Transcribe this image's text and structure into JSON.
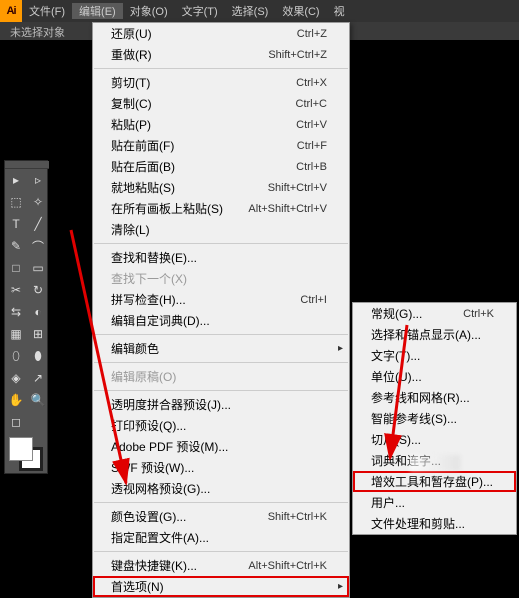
{
  "menubar": {
    "logo": "Ai",
    "items": [
      "文件(F)",
      "编辑(E)",
      "对象(O)",
      "文字(T)",
      "选择(S)",
      "效果(C)",
      "视"
    ]
  },
  "status": "未选择对象",
  "main_menu": [
    {
      "label": "还原(U)",
      "short": "Ctrl+Z"
    },
    {
      "label": "重做(R)",
      "short": "Shift+Ctrl+Z"
    },
    {
      "sep": true
    },
    {
      "label": "剪切(T)",
      "short": "Ctrl+X"
    },
    {
      "label": "复制(C)",
      "short": "Ctrl+C"
    },
    {
      "label": "粘贴(P)",
      "short": "Ctrl+V"
    },
    {
      "label": "贴在前面(F)",
      "short": "Ctrl+F"
    },
    {
      "label": "贴在后面(B)",
      "short": "Ctrl+B"
    },
    {
      "label": "就地粘贴(S)",
      "short": "Shift+Ctrl+V"
    },
    {
      "label": "在所有画板上粘贴(S)",
      "short": "Alt+Shift+Ctrl+V"
    },
    {
      "label": "清除(L)",
      "short": ""
    },
    {
      "sep": true
    },
    {
      "label": "查找和替换(E)...",
      "short": ""
    },
    {
      "label": "查找下一个(X)",
      "short": "",
      "disabled": true
    },
    {
      "label": "拼写检查(H)...",
      "short": "Ctrl+I"
    },
    {
      "label": "编辑自定词典(D)...",
      "short": ""
    },
    {
      "sep": true
    },
    {
      "label": "编辑颜色",
      "short": "",
      "sub": true
    },
    {
      "sep": true
    },
    {
      "label": "编辑原稿(O)",
      "short": "",
      "disabled": true
    },
    {
      "sep": true
    },
    {
      "label": "透明度拼合器预设(J)...",
      "short": ""
    },
    {
      "label": "打印预设(Q)...",
      "short": ""
    },
    {
      "label": "Adobe PDF 预设(M)...",
      "short": ""
    },
    {
      "label": "SWF 预设(W)...",
      "short": ""
    },
    {
      "label": "透视网格预设(G)...",
      "short": ""
    },
    {
      "sep": true
    },
    {
      "label": "颜色设置(G)...",
      "short": "Shift+Ctrl+K"
    },
    {
      "label": "指定配置文件(A)...",
      "short": ""
    },
    {
      "sep": true
    },
    {
      "label": "键盘快捷键(K)...",
      "short": "Alt+Shift+Ctrl+K"
    },
    {
      "label": "首选项(N)",
      "short": "",
      "sub": true,
      "hl": true
    }
  ],
  "sub_menu": [
    {
      "label": "常规(G)...",
      "short": "Ctrl+K"
    },
    {
      "label": "选择和锚点显示(A)...",
      "short": ""
    },
    {
      "label": "文字(T)...",
      "short": ""
    },
    {
      "label": "单位(U)...",
      "short": ""
    },
    {
      "label": "参考线和网格(R)...",
      "short": ""
    },
    {
      "label": "智能参考线(S)...",
      "short": ""
    },
    {
      "label": "切片(S)...",
      "short": ""
    },
    {
      "label": "词典和连字...",
      "short": ""
    },
    {
      "label": "增效工具和暂存盘(P)...",
      "short": "",
      "hl": true
    },
    {
      "label": "用户...",
      "short": ""
    },
    {
      "label": "文件处理和剪贴...",
      "short": ""
    }
  ],
  "tools": [
    "▸",
    "▹",
    "⬚",
    "✧",
    "T",
    "╱",
    "✎",
    "⌒",
    "□",
    "▭",
    "✂",
    "↻",
    "⇆",
    "◐",
    "▦",
    "⊞",
    "⬯",
    "⬮",
    "◈",
    "↗",
    "✋",
    "🔍",
    "◻",
    ""
  ]
}
